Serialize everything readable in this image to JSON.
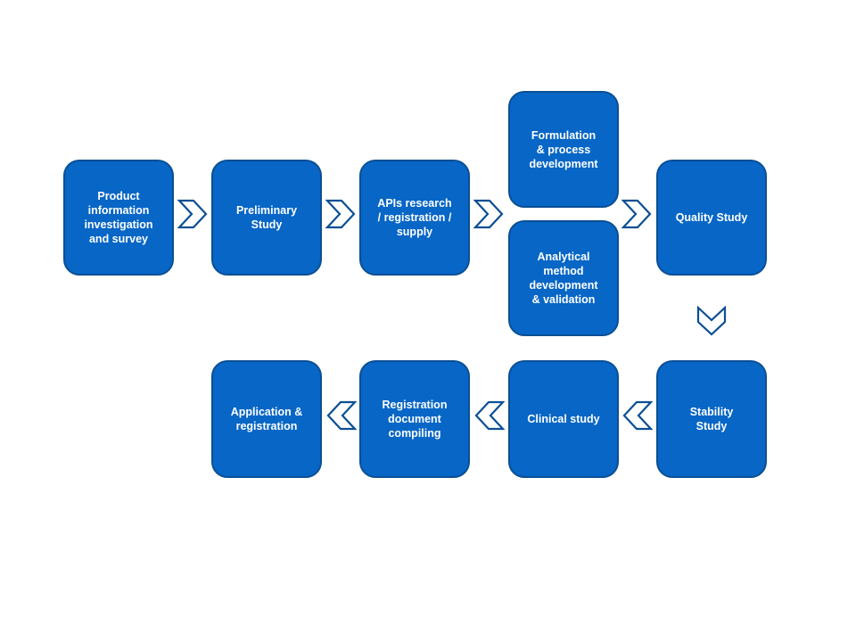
{
  "diagram": {
    "type": "process-flow",
    "colors": {
      "box_fill": "#0766c6",
      "box_border": "#0b4f94",
      "arrow_stroke": "#0b4f94",
      "text": "#ffffff",
      "background": "#ffffff"
    },
    "steps": [
      {
        "id": "product-info",
        "label": "Product\ninformation\ninvestigation\nand survey"
      },
      {
        "id": "preliminary",
        "label": "Preliminary\nStudy"
      },
      {
        "id": "apis",
        "label": "APIs research\n/ registration /\nsupply"
      },
      {
        "id": "formulation",
        "label": "Formulation\n& process\ndevelopment"
      },
      {
        "id": "analytical",
        "label": "Analytical\nmethod\ndevelopment\n& validation"
      },
      {
        "id": "quality",
        "label": "Quality Study"
      },
      {
        "id": "stability",
        "label": "Stability\nStudy"
      },
      {
        "id": "clinical",
        "label": "Clinical study"
      },
      {
        "id": "registration-doc",
        "label": "Registration\ndocument\ncompiling"
      },
      {
        "id": "application",
        "label": "Application &\nregistration"
      }
    ],
    "arrows": [
      {
        "from": "product-info",
        "to": "preliminary",
        "direction": "right"
      },
      {
        "from": "preliminary",
        "to": "apis",
        "direction": "right"
      },
      {
        "from": "apis",
        "to": "formulation/analytical",
        "direction": "right"
      },
      {
        "from": "formulation/analytical",
        "to": "quality",
        "direction": "right"
      },
      {
        "from": "quality",
        "to": "stability",
        "direction": "down"
      },
      {
        "from": "stability",
        "to": "clinical",
        "direction": "left"
      },
      {
        "from": "clinical",
        "to": "registration-doc",
        "direction": "left"
      },
      {
        "from": "registration-doc",
        "to": "application",
        "direction": "left"
      }
    ]
  }
}
